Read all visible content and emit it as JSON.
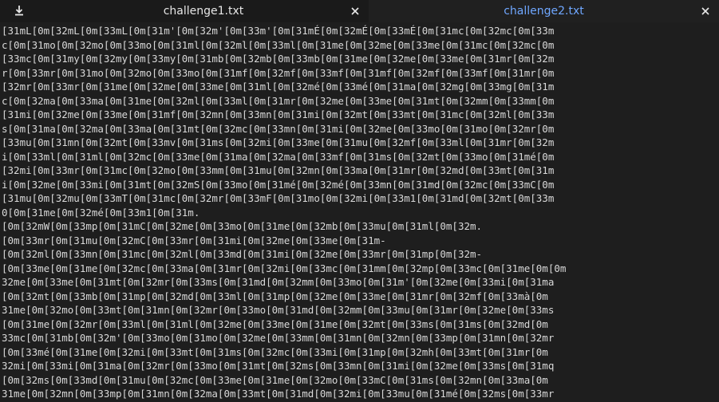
{
  "tabs": [
    {
      "label": "challenge1.txt",
      "active": false
    },
    {
      "label": "challenge2.txt",
      "active": true
    }
  ],
  "icons": {
    "download": "download-icon",
    "close": "close-icon"
  },
  "colors": {
    "background": "#1e1e1e",
    "tabbar": "#1a1a1a",
    "active_tab_text": "#6fa7ff",
    "text": "#d9d9d9"
  },
  "document": {
    "lines": [
      "[31mL[0m[32mL[0m[33mL[0m[31m'[0m[32m'[0m[33m'[0m[31mÉ[0m[32mÉ[0m[33mÉ[0m[31mc[0m[32mc[0m[33m",
      "c[0m[31mo[0m[32mo[0m[33mo[0m[31ml[0m[32ml[0m[33ml[0m[31me[0m[32me[0m[33me[0m[31mc[0m[32mc[0m",
      "[33mc[0m[31my[0m[32my[0m[33my[0m[31mb[0m[32mb[0m[33mb[0m[31me[0m[32me[0m[33me[0m[31mr[0m[32m",
      "r[0m[33mr[0m[31mo[0m[32mo[0m[33mo[0m[31mf[0m[32mf[0m[33mf[0m[31mf[0m[32mf[0m[33mf[0m[31mr[0m",
      "[32mr[0m[33mr[0m[31me[0m[32me[0m[33me[0m[31ml[0m[32mé[0m[33mé[0m[31ma[0m[32mg[0m[33mg[0m[31m",
      "c[0m[32ma[0m[33ma[0m[31me[0m[32ml[0m[33ml[0m[31mr[0m[32me[0m[33me[0m[31mt[0m[32mm[0m[33mm[0m",
      "[31mi[0m[32me[0m[33me[0m[31mf[0m[32mn[0m[33mn[0m[31mi[0m[32mt[0m[33mt[0m[31mc[0m[32ml[0m[33m",
      "s[0m[31ma[0m[32ma[0m[33ma[0m[31mt[0m[32mc[0m[33mn[0m[31mi[0m[32me[0m[33mo[0m[31mo[0m[32mr[0m",
      "[33mu[0m[31mn[0m[32mt[0m[33mv[0m[31ms[0m[32mi[0m[33me[0m[31mu[0m[32mf[0m[33ml[0m[31mr[0m[32m",
      "i[0m[33ml[0m[31ml[0m[32mc[0m[33me[0m[31ma[0m[32ma[0m[33mf[0m[31ms[0m[32mt[0m[33mo[0m[31mé[0m",
      "[32mi[0m[33mr[0m[31mc[0m[32mo[0m[33mm[0m[31mu[0m[32mn[0m[33ma[0m[31mr[0m[32md[0m[33mt[0m[31m",
      "i[0m[32me[0m[33mi[0m[31mt[0m[32mS[0m[33mo[0m[31mé[0m[32mé[0m[33mn[0m[31md[0m[32mc[0m[33mC[0m",
      "[31mu[0m[32mu[0m[33mT[0m[31mc[0m[32mr[0m[33mF[0m[31mo[0m[32mi[0m[33m1[0m[31md[0m[32mt[0m[33m",
      "0[0m[31me[0m[32mé[0m[33m1[0m[31m.",
      "[0m[32mW[0m[33mp[0m[31mC[0m[32me[0m[33mo[0m[31me[0m[32mb[0m[33mu[0m[31ml[0m[32m.",
      "[0m[33mr[0m[31mu[0m[32mC[0m[33mr[0m[31mi[0m[32me[0m[33me[0m[31m-",
      "[0m[32ml[0m[33mn[0m[31mc[0m[32ml[0m[33md[0m[31mi[0m[32me[0m[33mr[0m[31mp[0m[32m-",
      "[0m[33me[0m[31me[0m[32mc[0m[33ma[0m[31mr[0m[32mi[0m[33mc[0m[31mm[0m[32mp[0m[33mc[0m[31me[0m[0m",
      "32me[0m[33me[0m[31mt[0m[32mr[0m[33ms[0m[31md[0m[32mm[0m[33mo[0m[31m'[0m[32me[0m[33mi[0m[31ma",
      "[0m[32mt[0m[33mb[0m[31mp[0m[32md[0m[33ml[0m[31mp[0m[32me[0m[33me[0m[31mr[0m[32mf[0m[33mà[0m",
      "31me[0m[32mo[0m[33mt[0m[31mn[0m[32mr[0m[33mo[0m[31md[0m[32mm[0m[33mu[0m[31mr[0m[32me[0m[33ms",
      "[0m[31me[0m[32mr[0m[33ml[0m[31ml[0m[32me[0m[33me[0m[31me[0m[32mt[0m[33ms[0m[31ms[0m[32md[0m",
      "33mc[0m[31mb[0m[32m'[0m[33mo[0m[31mo[0m[32me[0m[33mm[0m[31mn[0m[32mn[0m[33mp[0m[31mn[0m[32mr",
      "[0m[33mé[0m[31me[0m[32mi[0m[33mt[0m[31ms[0m[32mc[0m[33mi[0m[31mp[0m[32mh[0m[33mt[0m[31mr[0m",
      "32mi[0m[33mi[0m[31ma[0m[32mr[0m[33mo[0m[31mt[0m[32ms[0m[33mn[0m[31mi[0m[32me[0m[33ms[0m[31mq",
      "[0m[32ms[0m[33md[0m[31mu[0m[32mc[0m[33me[0m[31me[0m[32mo[0m[33mC[0m[31ms[0m[32mn[0m[33ma[0m",
      "31me[0m[32mn[0m[33mp[0m[31mn[0m[32ma[0m[33mt[0m[31md[0m[32mi[0m[33mu[0m[31mé[0m[32ms[0m[33mr",
      "[31mv[0m[32ms[0m[33me[0m[31me[0m[32ma[0m[33mT[0m[31ml[0m[32mn[0m[33mh[0m[31mo[0m[32ms[0m"
    ]
  }
}
